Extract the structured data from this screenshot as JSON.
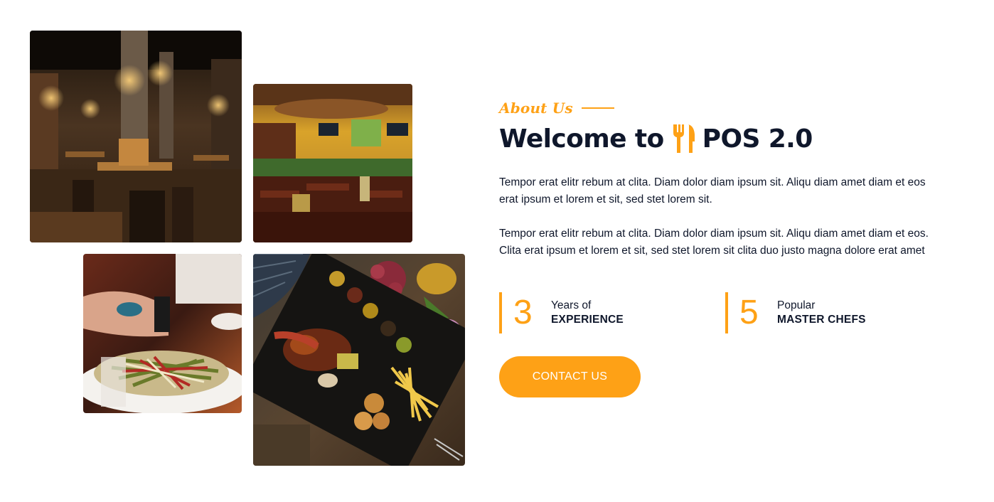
{
  "images": [
    {
      "name": "restaurant-interior-photo-1"
    },
    {
      "name": "restaurant-interior-photo-2"
    },
    {
      "name": "salad-dish-photo"
    },
    {
      "name": "grilled-platter-photo"
    }
  ],
  "about": {
    "label": "About Us",
    "headline_prefix": "Welcome to",
    "brand_icon": "utensils-icon",
    "brand_name": "POS 2.0",
    "paragraphs": [
      "Tempor erat elitr rebum at clita. Diam dolor diam ipsum sit. Aliqu diam amet diam et eos erat ipsum et lorem et sit, sed stet lorem sit.",
      "Tempor erat elitr rebum at clita. Diam dolor diam ipsum sit. Aliqu diam amet diam et eos. Clita erat ipsum et lorem et sit, sed stet lorem sit clita duo justo magna dolore erat amet"
    ]
  },
  "stats": [
    {
      "number": "3",
      "label": "Years of",
      "strong": "EXPERIENCE"
    },
    {
      "number": "5",
      "label": "Popular",
      "strong": "MASTER CHEFS"
    }
  ],
  "cta": {
    "label": "CONTACT US"
  },
  "colors": {
    "accent": "#FEA116",
    "dark": "#0F172B"
  }
}
